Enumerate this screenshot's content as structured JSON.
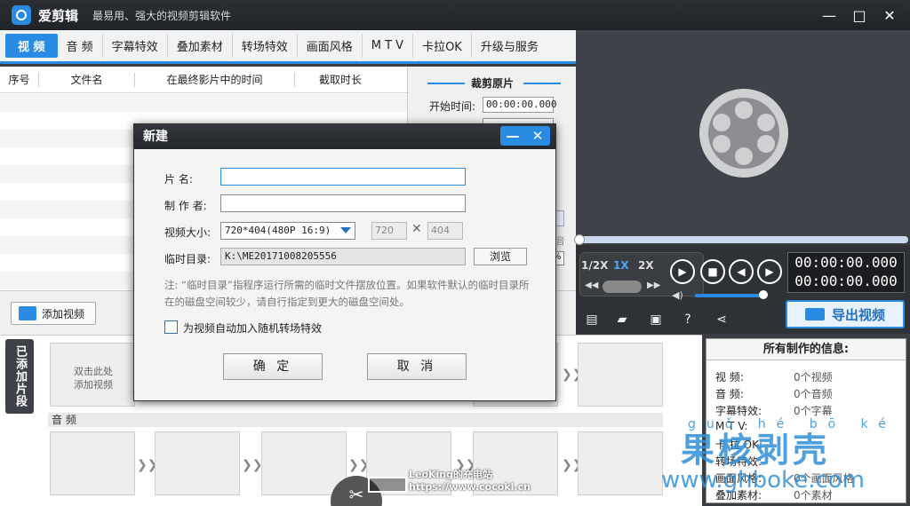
{
  "app": {
    "name": "爱剪辑",
    "slogan": "最易用、强大的视频剪辑软件"
  },
  "window_controls": {
    "minimize": "—",
    "maximize": "□",
    "close": "✕"
  },
  "tabs": [
    {
      "label": "视 频",
      "active": true
    },
    {
      "label": "音 频"
    },
    {
      "label": "字幕特效"
    },
    {
      "label": "叠加素材"
    },
    {
      "label": "转场特效"
    },
    {
      "label": "画面风格"
    },
    {
      "label": "M T V"
    },
    {
      "label": "卡拉OK"
    },
    {
      "label": "升级与服务"
    }
  ],
  "table": {
    "headers": [
      "序号",
      "文件名",
      "在最终影片中的时间",
      "截取时长"
    ]
  },
  "crop": {
    "title": "裁剪原片",
    "start_label": "开始时间:",
    "start_value": "00:00:00.000",
    "extra": "音",
    "pct": "%"
  },
  "player": {
    "speeds": [
      "1/2X",
      "1X",
      "2X"
    ],
    "timecode_top": "00:00:00.000",
    "timecode_bottom": "00:00:00.000"
  },
  "export": {
    "label": "导出视频"
  },
  "add_video": {
    "label": "添加视频"
  },
  "clips": {
    "side_tab": "已添加片段",
    "placeholder": "双击此处\n添加视频",
    "audio_label": "音 频"
  },
  "watermark": {
    "leoking_line1": "LeoKing的充电站",
    "leoking_line2": "https://www.cocokl.cn"
  },
  "site_watermark": {
    "pinyin": "guǒ hé bō ké",
    "chinese": "果核剥壳",
    "url": "www.ghboke.com"
  },
  "info": {
    "title": "所有制作的信息:",
    "rows": [
      {
        "k": "视    频:",
        "v": "0个视频"
      },
      {
        "k": "音    频:",
        "v": "0个音频"
      },
      {
        "k": "字幕特效:",
        "v": "0个字幕"
      },
      {
        "k": "M  T  V:",
        "v": ""
      },
      {
        "k": "卡 拉 OK:",
        "v": ""
      },
      {
        "k": "转场特效:",
        "v": ""
      },
      {
        "k": "画面风格:",
        "v": "0个画面风格"
      },
      {
        "k": "叠加素材:",
        "v": "0个素材"
      }
    ]
  },
  "dialog": {
    "title": "新建",
    "name_label": "片    名:",
    "name_value": "",
    "author_label": "制 作 者:",
    "author_value": "",
    "size_label": "视频大小:",
    "size_value": "720*404(480P 16:9)",
    "width": "720",
    "height": "404",
    "temp_label": "临时目录:",
    "temp_value": "K:\\ME20171008205556",
    "browse": "浏览",
    "note": "注: “临时目录”指程序运行所需的临时文件摆放位置。如果软件默认的临时目录所在的磁盘空间较少，请自行指定到更大的磁盘空间处。",
    "checkbox_label": "为视频自动加入随机转场特效",
    "ok": "确 定",
    "cancel": "取 消"
  }
}
